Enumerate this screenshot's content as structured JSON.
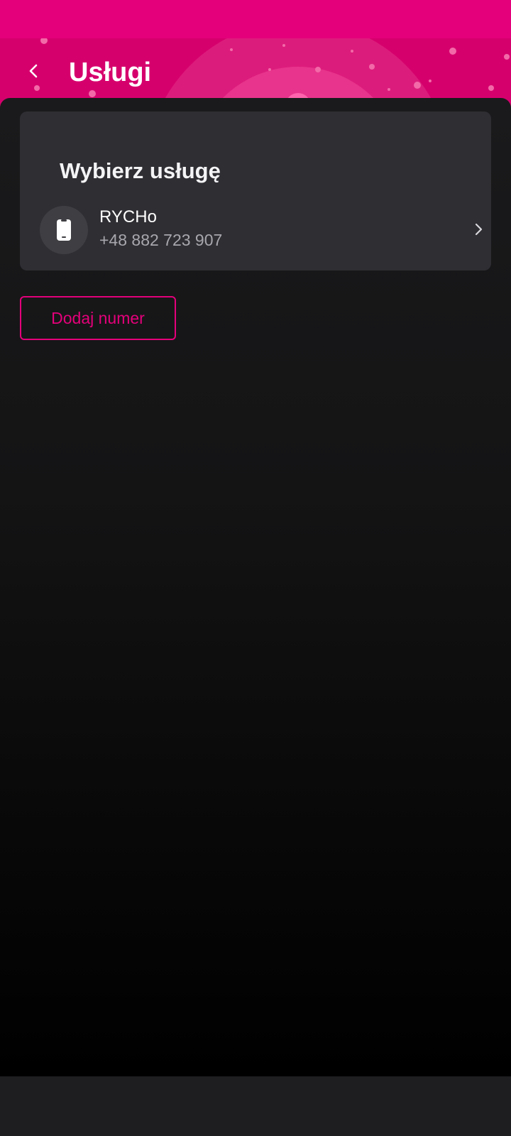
{
  "header": {
    "title": "Usługi",
    "back_icon": "chevron-left-icon"
  },
  "card": {
    "title": "Wybierz usługę",
    "service": {
      "name": "RYCHo",
      "number": "+48 882 723 907",
      "icon": "smartphone-icon",
      "arrow_icon": "chevron-right-icon"
    }
  },
  "actions": {
    "add_number_label": "Dodaj numer"
  },
  "colors": {
    "brand": "#e4007a",
    "header": "#d6006d",
    "card": "#2e2e33",
    "background": "#141415"
  }
}
